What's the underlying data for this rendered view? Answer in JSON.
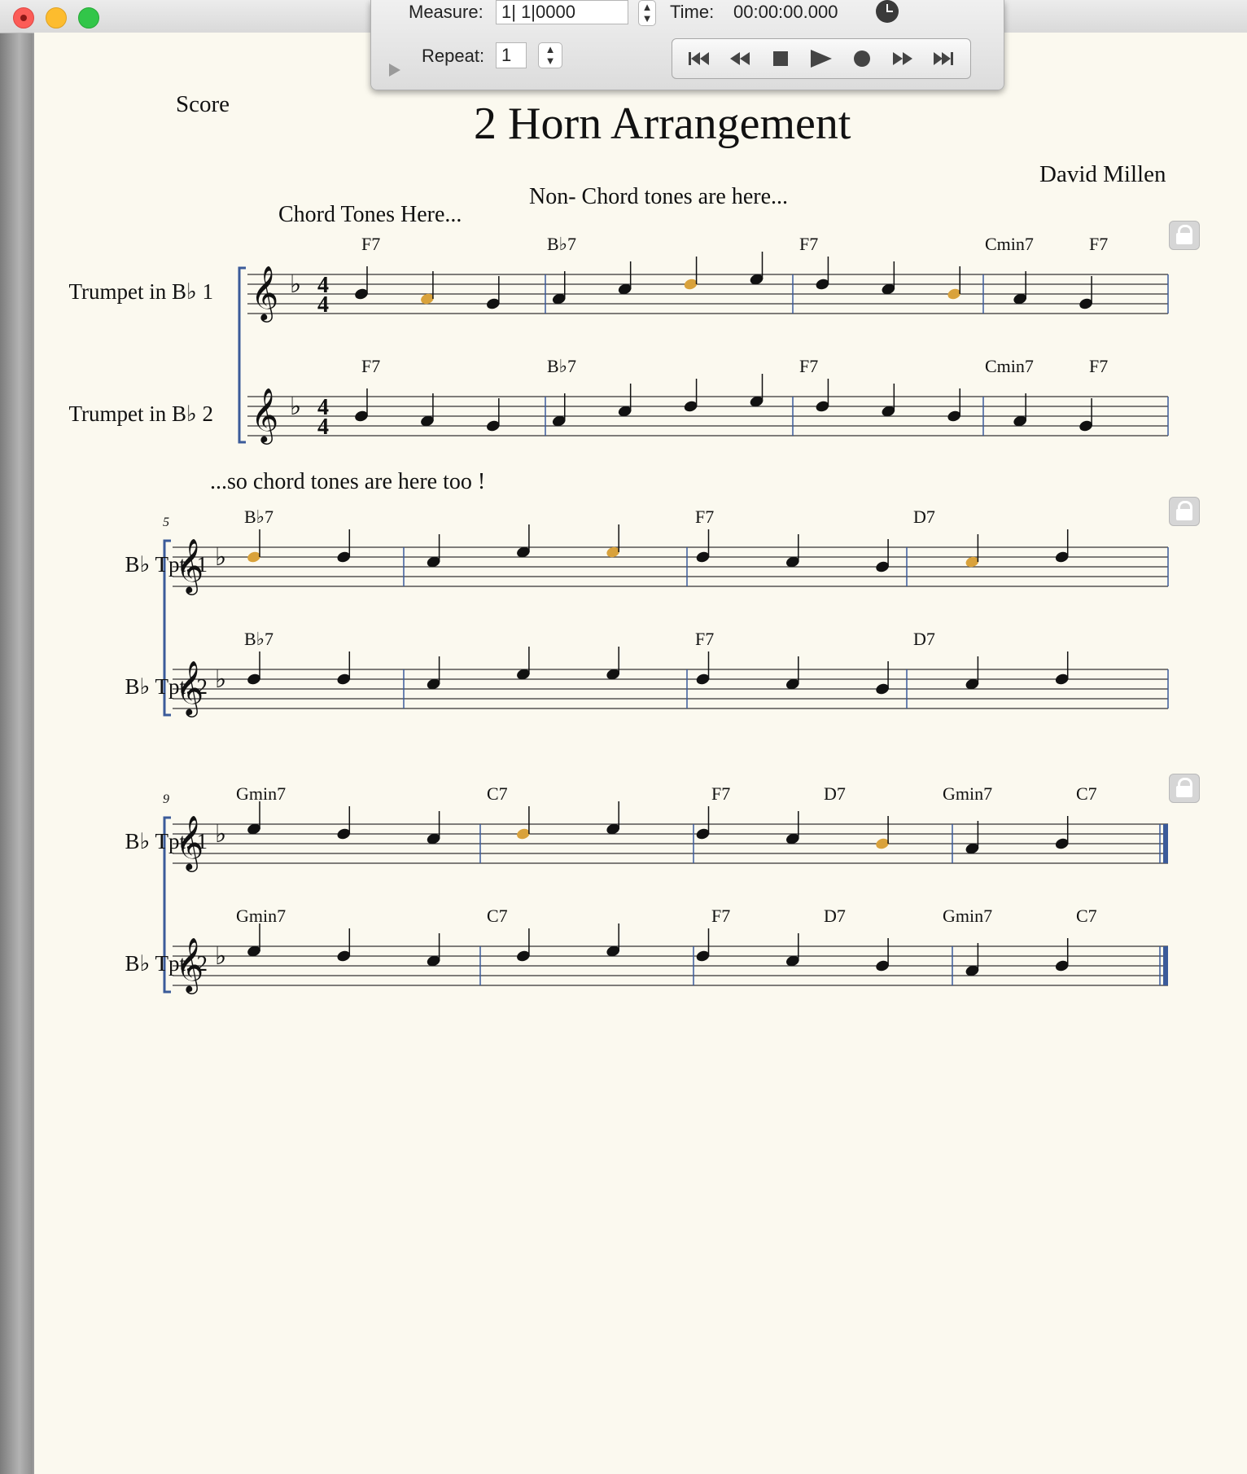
{
  "window": {
    "controls": [
      "close",
      "minimize",
      "zoom"
    ]
  },
  "transport": {
    "measure_label": "Measure:",
    "measure_value": "1| 1|0000",
    "time_label": "Time:",
    "time_value": "00:00:00.000",
    "repeat_label": "Repeat:",
    "repeat_value": "1",
    "buttons": [
      "rewind-to-start",
      "rewind",
      "stop",
      "play",
      "record",
      "fast-forward",
      "forward-to-end"
    ]
  },
  "score": {
    "header_label": "Score",
    "title": "2 Horn Arrangement",
    "composer": "David Millen",
    "annotations": {
      "non_chord": "Non- Chord tones are here...",
      "chord_tones": "Chord Tones Here...",
      "chord_tones_too": "...so chord tones are here too !"
    },
    "key_signature": "F major (one flat)",
    "time_signature": "4/4",
    "highlight_color": "#d9a23b",
    "systems": [
      {
        "measure_number": "",
        "staves": [
          {
            "name": "Trumpet in B♭ 1",
            "chords": [
              "F7",
              "B♭7",
              "F7",
              "Cmin7",
              "F7"
            ]
          },
          {
            "name": "Trumpet in B♭ 2",
            "chords": [
              "F7",
              "B♭7",
              "F7",
              "Cmin7",
              "F7"
            ]
          }
        ]
      },
      {
        "measure_number": "5",
        "staves": [
          {
            "name": "B♭ Tpt. 1",
            "chords": [
              "B♭7",
              "F7",
              "D7"
            ]
          },
          {
            "name": "B♭ Tpt. 2",
            "chords": [
              "B♭7",
              "F7",
              "D7"
            ]
          }
        ]
      },
      {
        "measure_number": "9",
        "staves": [
          {
            "name": "B♭ Tpt. 1",
            "chords": [
              "Gmin7",
              "C7",
              "F7",
              "D7",
              "Gmin7",
              "C7"
            ]
          },
          {
            "name": "B♭ Tpt. 2",
            "chords": [
              "Gmin7",
              "C7",
              "F7",
              "D7",
              "Gmin7",
              "C7"
            ]
          }
        ]
      }
    ]
  }
}
